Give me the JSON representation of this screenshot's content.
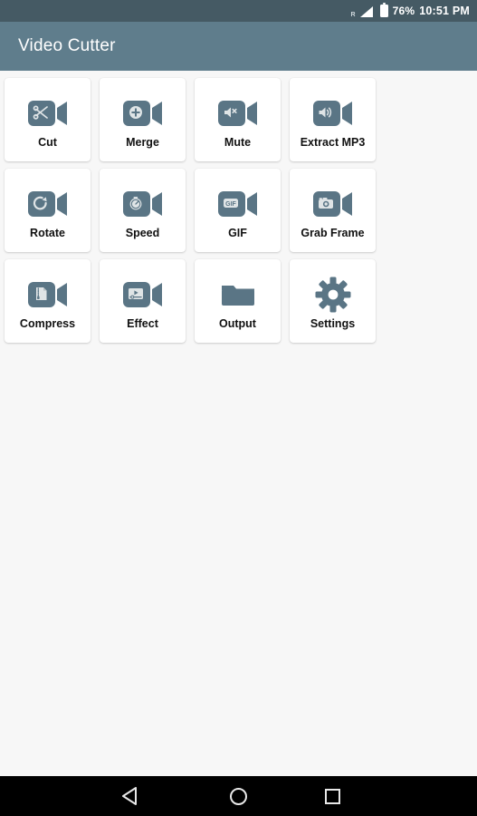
{
  "status_bar": {
    "roaming": "R",
    "signal_icon": "signal-bars-icon",
    "battery_icon": "battery-icon",
    "battery_percent": "76%",
    "time": "10:51 PM",
    "background": "#455a64"
  },
  "app_bar": {
    "title": "Video Cutter",
    "background": "#5f7d8c"
  },
  "theme": {
    "page_background": "#f7f7f7",
    "tile_background": "#ffffff",
    "icon_slate": "#5a7585",
    "icon_light": "#dfe4e6",
    "label_color": "#111111"
  },
  "grid": {
    "tiles": [
      {
        "label": "Cut",
        "icon": "scissors-video-icon",
        "framed": true
      },
      {
        "label": "Merge",
        "icon": "plus-circle-video-icon",
        "framed": true
      },
      {
        "label": "Mute",
        "icon": "speaker-mute-video-icon",
        "framed": true
      },
      {
        "label": "Extract MP3",
        "icon": "speaker-wave-video-icon",
        "framed": true
      },
      {
        "label": "Rotate",
        "icon": "rotate-video-icon",
        "framed": true
      },
      {
        "label": "Speed",
        "icon": "stopwatch-video-icon",
        "framed": true
      },
      {
        "label": "GIF",
        "icon": "gif-badge-video-icon",
        "framed": true
      },
      {
        "label": "Grab Frame",
        "icon": "photo-camera-video-icon",
        "framed": true
      },
      {
        "label": "Compress",
        "icon": "zip-document-video-icon",
        "framed": true
      },
      {
        "label": "Effect",
        "icon": "play-slider-video-icon",
        "framed": true
      },
      {
        "label": "Output",
        "icon": "folder-icon",
        "framed": false
      },
      {
        "label": "Settings",
        "icon": "gear-icon",
        "framed": false
      }
    ]
  },
  "nav_bar": {
    "back_label": "back-icon",
    "home_label": "home-icon",
    "recents_label": "recents-icon",
    "background": "#000000"
  }
}
